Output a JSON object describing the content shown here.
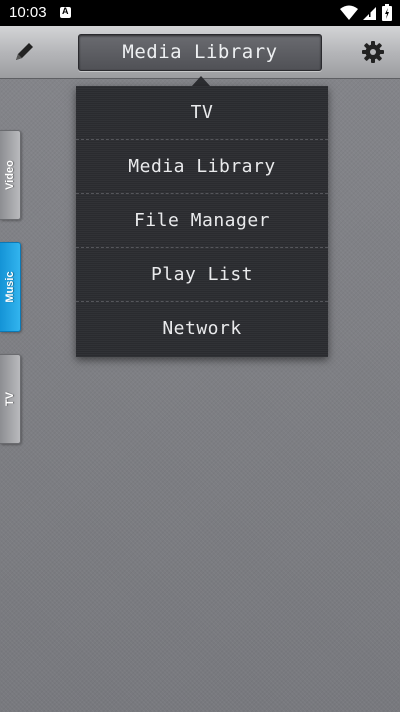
{
  "status_bar": {
    "time": "10:03",
    "notification_icon": "a-badge-icon",
    "icons": [
      "wifi-icon",
      "signal-icon",
      "battery-icon"
    ]
  },
  "toolbar": {
    "title": "Media Library",
    "edit_icon": "pencil-icon",
    "settings_icon": "gear-icon"
  },
  "dropdown": {
    "items": [
      "TV",
      "Media Library",
      "File Manager",
      "Play List",
      "Network"
    ]
  },
  "side_tabs": [
    {
      "label": "Video",
      "active": false
    },
    {
      "label": "Music",
      "active": true
    },
    {
      "label": "TV",
      "active": false
    }
  ],
  "colors": {
    "accent": "#1e9fe0",
    "background": "#7e7f84",
    "menu_bg": "#2a2b2f"
  }
}
